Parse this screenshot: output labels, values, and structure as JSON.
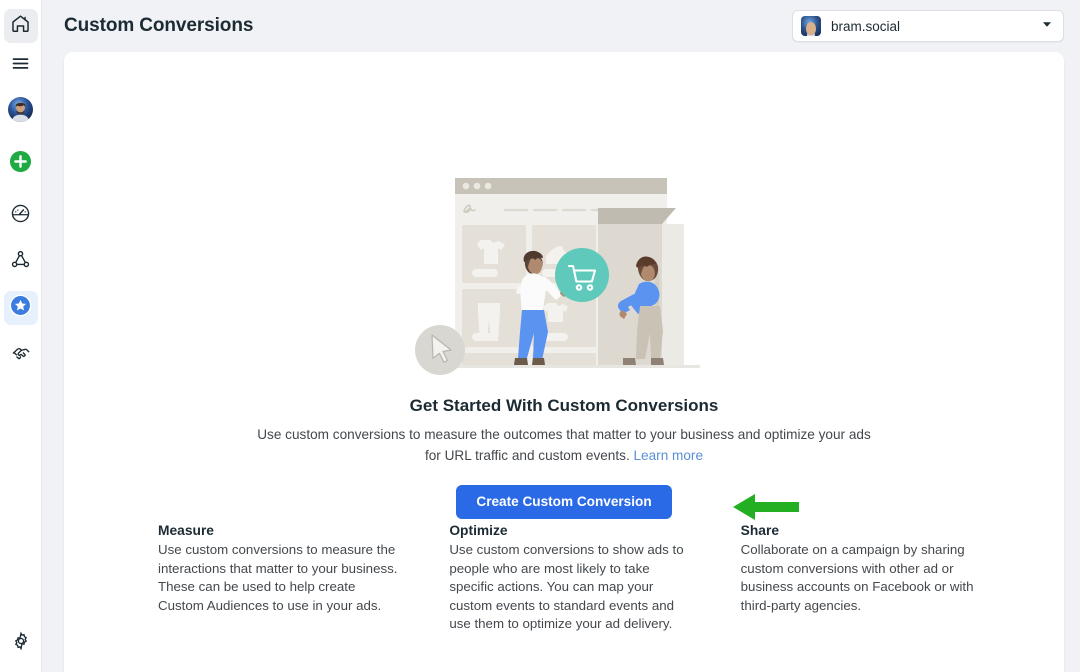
{
  "header": {
    "title": "Custom Conversions",
    "account": {
      "name": "bram.social",
      "avatar_icon": "user-avatar",
      "caret_icon": "chevron-down-icon"
    }
  },
  "sidebar": {
    "items": [
      {
        "icon": "home-icon",
        "name": "home"
      },
      {
        "icon": "menu-icon",
        "name": "menu"
      },
      {
        "icon": "avatar-icon",
        "name": "profile"
      },
      {
        "icon": "plus-circle-icon",
        "name": "create"
      },
      {
        "icon": "gauge-icon",
        "name": "performance"
      },
      {
        "icon": "network-icon",
        "name": "audiences"
      },
      {
        "icon": "star-circle-icon",
        "name": "custom-conversions"
      },
      {
        "icon": "handshake-icon",
        "name": "partnerships"
      }
    ],
    "footer": {
      "icon": "gear-icon",
      "name": "settings"
    }
  },
  "hero": {
    "title": "Get Started With Custom Conversions",
    "description": "Use custom conversions to measure the outcomes that matter to your business and optimize your ads for URL traffic and custom events.",
    "learn_more": "Learn more",
    "cta_label": "Create Custom Conversion",
    "annotation_arrow": "green-left-arrow",
    "illustration": {
      "name": "storefront-shopping-illustration",
      "badge_icon": "shopping-cart-icon",
      "cursor_icon": "cursor-arrow-icon",
      "badge_color": "#5fc9bc"
    }
  },
  "features": [
    {
      "title": "Measure",
      "body": "Use custom conversions to measure the interactions that matter to your business. These can be used to help create Custom Audiences to use in your ads."
    },
    {
      "title": "Optimize",
      "body": "Use custom conversions to show ads to people who are most likely to take specific actions. You can map your custom events to standard events and use them to optimize your ad delivery."
    },
    {
      "title": "Share",
      "body": "Collaborate on a campaign by sharing custom conversions with other ad or business accounts on Facebook or with third-party agencies."
    }
  ],
  "colors": {
    "accent_blue": "#2a6ae6",
    "link_blue": "#5a8fd6",
    "annotation_green": "#22b022",
    "page_bg": "#f0f2f5"
  }
}
